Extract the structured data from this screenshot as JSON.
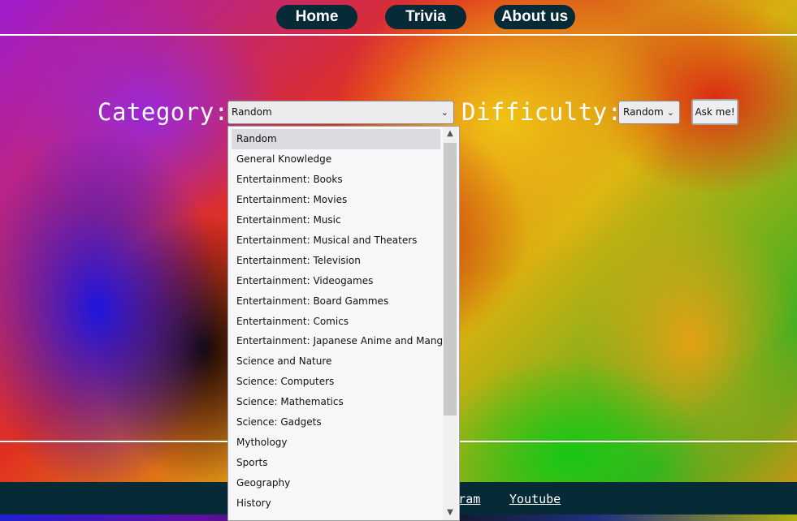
{
  "nav": {
    "home": "Home",
    "trivia": "Trivia",
    "about": "About us"
  },
  "form": {
    "category_label": "Category:",
    "category_value": "Random",
    "difficulty_label": "Difficulty:",
    "difficulty_value": "Random",
    "ask_button": "Ask me!"
  },
  "dropdown": {
    "options": [
      "Random",
      "General Knowledge",
      "Entertainment: Books",
      "Entertainment: Movies",
      "Entertainment: Music",
      "Entertainment: Musical and Theaters",
      "Entertainment: Television",
      "Entertainment: Videogames",
      "Entertainment: Board Gammes",
      "Entertainment: Comics",
      "Entertainment: Japanese Anime and Manga",
      "Science and Nature",
      "Science: Computers",
      "Science: Mathematics",
      "Science: Gadgets",
      "Mythology",
      "Sports",
      "Geography",
      "History"
    ],
    "selected": "Random"
  },
  "footer": {
    "instagram": "Instagram",
    "youtube": "Youtube"
  },
  "icons": {
    "select_chevron": "chevron-down-icon",
    "scroll_up": "chevron-up-icon",
    "scroll_down": "chevron-down-icon"
  }
}
